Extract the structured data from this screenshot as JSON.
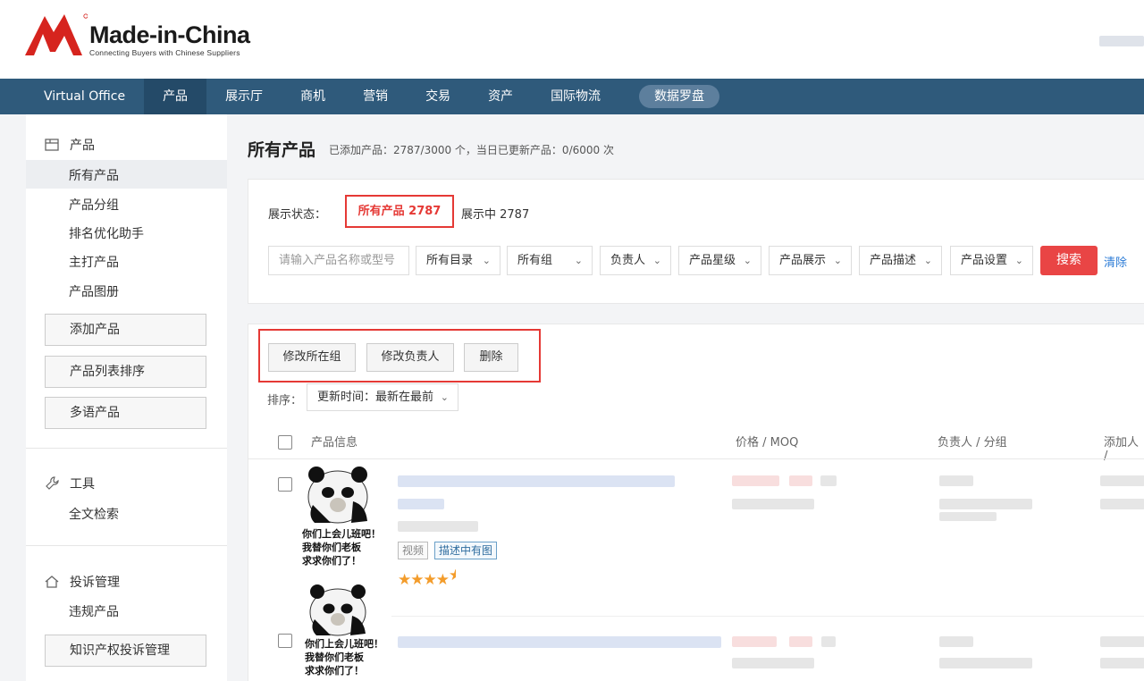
{
  "header": {
    "logo_text": "Made-in-China",
    "logo_tagline": "Connecting Buyers with Chinese Suppliers"
  },
  "nav": {
    "items": [
      "Virtual Office",
      "产品",
      "展示厅",
      "商机",
      "营销",
      "交易",
      "资产",
      "国际物流"
    ],
    "active_index": 1,
    "pill": "数据罗盘"
  },
  "sidebar": {
    "product_group": {
      "title": "产品",
      "items": [
        "所有产品",
        "产品分组",
        "排名优化助手",
        "主打产品",
        "产品图册"
      ],
      "active_index": 0
    },
    "buttons": [
      "添加产品",
      "产品列表排序",
      "多语产品"
    ],
    "tools_group": {
      "title": "工具",
      "items": [
        "全文检索"
      ]
    },
    "complaint_group": {
      "title": "投诉管理",
      "items": [
        "违规产品"
      ],
      "button": "知识产权投诉管理"
    }
  },
  "main": {
    "title": "所有产品",
    "subtitle": "已添加产品：2787/3000 个，当日已更新产品：0/6000 次",
    "filters": {
      "status_label": "展示状态：",
      "status_all": "所有产品 2787",
      "status_showing": "展示中 2787",
      "search_placeholder": "请输入产品名称或型号",
      "dropdowns": [
        "所有目录",
        "所有组",
        "负责人",
        "产品星级",
        "产品展示",
        "产品描述",
        "产品设置"
      ],
      "search_button": "搜索",
      "clear_link": "清除"
    },
    "bulk_actions": [
      "修改所在组",
      "修改负责人",
      "删除"
    ],
    "sort": {
      "label": "排序：",
      "value": "更新时间：最新在最前"
    },
    "table": {
      "headers": [
        "产品信息",
        "价格 / MOQ",
        "负责人 / 分组",
        "添加人 /"
      ]
    },
    "rows": [
      {
        "meme_caption": [
          "你们上会儿班吧！",
          "我替你们老板",
          "求求你们了！"
        ],
        "tags": [
          "视频",
          "描述中有图"
        ],
        "rating": 4.5
      },
      {
        "meme_caption": [
          "你们上会儿班吧！",
          "我替你们老板",
          "求求你们了！"
        ]
      }
    ]
  },
  "colors": {
    "nav_bg": "#2f5a7b",
    "nav_active": "#244a68",
    "accent_red": "#e53935",
    "search_button": "#e94545",
    "link_blue": "#2b7bd6",
    "star": "#f39c2b"
  }
}
